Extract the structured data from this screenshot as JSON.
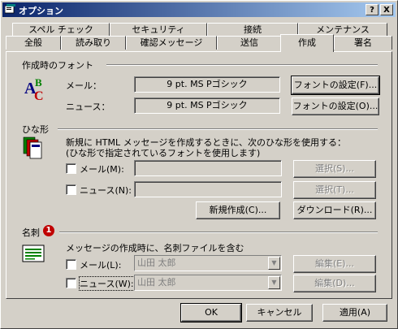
{
  "window": {
    "title": "オプション",
    "help_label": "?",
    "close_label": "X"
  },
  "tabs_row1": [
    {
      "label": "スペル チェック"
    },
    {
      "label": "セキュリティ"
    },
    {
      "label": "接続"
    },
    {
      "label": "メンテナンス"
    }
  ],
  "tabs_row2": [
    {
      "label": "全般"
    },
    {
      "label": "読み取り"
    },
    {
      "label": "確認メッセージ"
    },
    {
      "label": "送信"
    },
    {
      "label": "作成",
      "active": true
    },
    {
      "label": "署名"
    }
  ],
  "fonts": {
    "heading": "作成時のフォント",
    "mail_label": "メール：",
    "mail_value": "9 pt. MS Pゴシック",
    "mail_button": "フォントの設定(F)...",
    "news_label": "ニュース：",
    "news_value": "9 pt. MS Pゴシック",
    "news_button": "フォントの設定(O)..."
  },
  "stationery": {
    "heading": "ひな形",
    "desc1": "新規に HTML メッセージを作成するときに、次のひな形を使用する：",
    "desc2": "(ひな形で指定されているフォントを使用します)",
    "mail_label": "メール(M):",
    "news_label": "ニュース(N):",
    "select_mail": "選択(S)...",
    "select_news": "選択(T)...",
    "new_button": "新規作成(C)...",
    "download_button": "ダウンロード(R)..."
  },
  "business_card": {
    "heading": "名刺",
    "badge": "1",
    "desc": "メッセージの作成時に、名刺ファイルを含む",
    "mail_label": "メール(L):",
    "mail_value": "山田 太郎",
    "mail_edit": "編集(E)...",
    "news_label": "ニュース(W):",
    "news_value": "山田 太郎",
    "news_edit": "編集(D)..."
  },
  "footer": {
    "ok": "OK",
    "cancel": "キャンセル",
    "apply": "適用(A)"
  }
}
